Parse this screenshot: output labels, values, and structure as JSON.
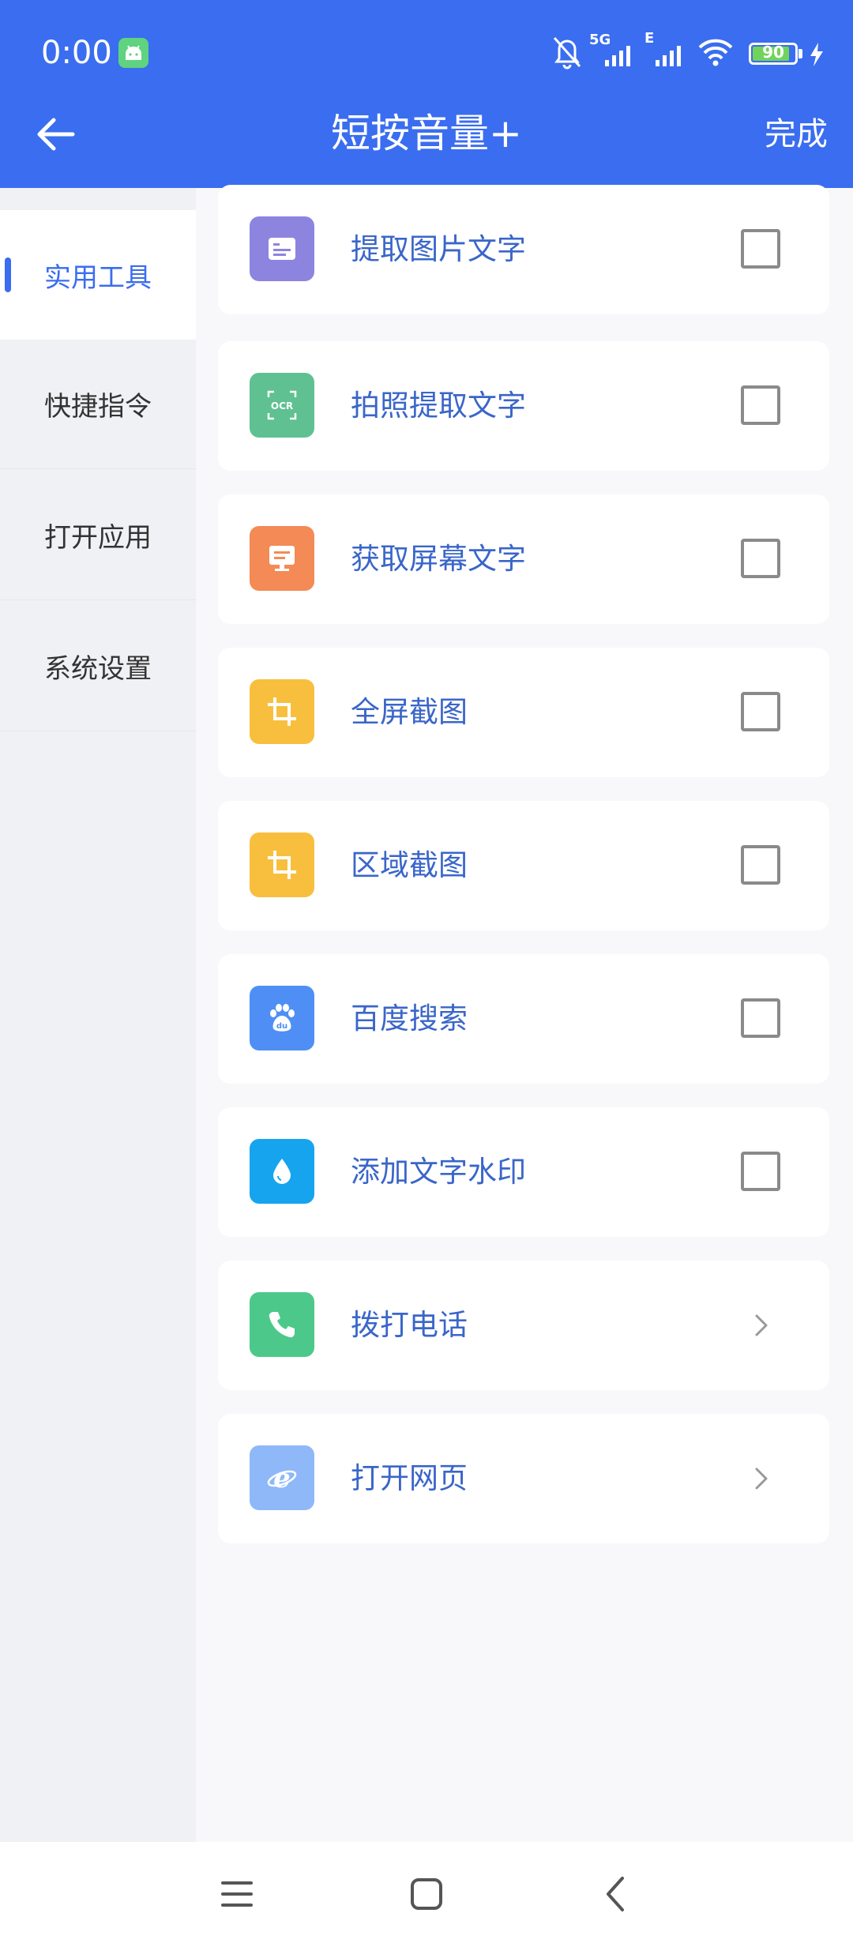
{
  "status_bar": {
    "time": "0:00",
    "network_labels": [
      "5G",
      "E"
    ],
    "battery_percent": 90,
    "battery_label": "90",
    "icons": [
      "android-icon",
      "mute-bell-icon",
      "signal-icon",
      "wifi-icon",
      "battery-icon",
      "charging-icon"
    ]
  },
  "header": {
    "title": "短按音量+",
    "done_label": "完成",
    "back_icon": "arrow-left-icon"
  },
  "sidebar": {
    "items": [
      {
        "label": "实用工具",
        "active": true
      },
      {
        "label": "快捷指令",
        "active": false
      },
      {
        "label": "打开应用",
        "active": false
      },
      {
        "label": "系统设置",
        "active": false
      }
    ]
  },
  "actions": [
    {
      "label": "提取图片文字",
      "icon": "image-text-icon",
      "icon_color": "#8d84e0",
      "control": "checkbox",
      "checked": false
    },
    {
      "label": "拍照提取文字",
      "icon": "ocr-icon",
      "icon_color": "#5fc191",
      "control": "checkbox",
      "checked": false
    },
    {
      "label": "获取屏幕文字",
      "icon": "screen-text-icon",
      "icon_color": "#f48a55",
      "control": "checkbox",
      "checked": false
    },
    {
      "label": "全屏截图",
      "icon": "crop-icon",
      "icon_color": "#f8bf3e",
      "control": "checkbox",
      "checked": false
    },
    {
      "label": "区域截图",
      "icon": "crop-icon",
      "icon_color": "#f8bf3e",
      "control": "checkbox",
      "checked": false
    },
    {
      "label": "百度搜索",
      "icon": "baidu-paw-icon",
      "icon_color": "#4f8ff5",
      "control": "checkbox",
      "checked": false
    },
    {
      "label": "添加文字水印",
      "icon": "water-drop-icon",
      "icon_color": "#16a4ef",
      "control": "checkbox",
      "checked": false
    },
    {
      "label": "拨打电话",
      "icon": "phone-icon",
      "icon_color": "#4cc98a",
      "control": "chevron"
    },
    {
      "label": "打开网页",
      "icon": "browser-e-icon",
      "icon_color": "#8fb8f8",
      "control": "chevron"
    }
  ],
  "nav_bar": {
    "buttons": [
      "menu-icon",
      "home-icon",
      "back-icon"
    ]
  }
}
